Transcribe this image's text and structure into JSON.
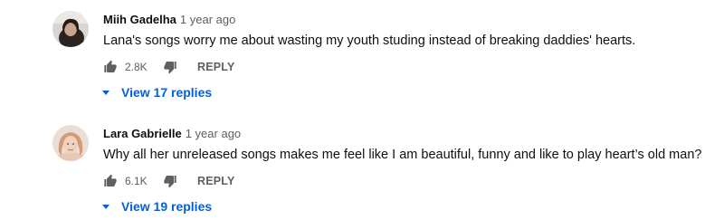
{
  "comments": [
    {
      "author": "Miih Gadelha",
      "time": "1 year ago",
      "text": "Lana's songs worry me about wasting my youth studing instead of breaking daddies' hearts.",
      "likes": "2.8K",
      "reply_label": "REPLY",
      "view_replies": "View 17 replies"
    },
    {
      "author": "Lara Gabrielle",
      "time": "1 year ago",
      "text": "Why all her unreleased songs makes me feel like I am beautiful, funny and like to play heart’s old man?",
      "likes": "6.1K",
      "reply_label": "REPLY",
      "view_replies": "View 19 replies"
    }
  ],
  "icons": {
    "like": "thumbs-up-icon",
    "dislike": "thumbs-down-icon",
    "expand": "caret-down-icon"
  },
  "colors": {
    "link": "#065fd4",
    "secondary_text": "#606060",
    "primary_text": "#0f0f0f"
  }
}
